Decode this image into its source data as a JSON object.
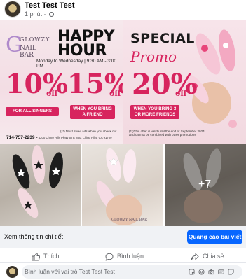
{
  "post": {
    "page_name": "Test Test Test",
    "time": "1 phút"
  },
  "banner": {
    "logo_brand": "GLOWZY",
    "logo_sub": "NAIL BAR",
    "happy_line1": "HAPPY",
    "happy_line2": "HOUR",
    "happy_time": "Monday to Wednesday  |  9:30 AM - 3:00 PM",
    "deal1_value": "10%",
    "deal1_off": "off",
    "deal1_label": "FOR ALL SINGERS",
    "deal2_value": "15%",
    "deal2_off": "off",
    "deal2_label_line1": "WHEN YOU BRING",
    "deal2_label_line2": "A FRIEND",
    "phone": "714-757-2239",
    "address": "• 4200 Chino Hills Pkwy STE 850, Chino Hills, CA  91709",
    "note1_line1": "(**) Must show ads when you check out",
    "note1_line2": "(**) Cannot combine with other promotions",
    "special": "SPECIAL",
    "promo": "Promo",
    "deal3_value": "20%",
    "deal3_off": "off",
    "deal3_label_line1": "WHEN YOU BRING 3",
    "deal3_label_line2": "OR MORE FRIENDS",
    "note2_line1": "(**)This offer is valid until the end of September 2024",
    "note2_line2": "and cannot be combined with other promotions",
    "brand_color": "#d7245e"
  },
  "photos": {
    "more_count": "+7",
    "watermark": "GLOWZY NAIL BAR"
  },
  "cta": {
    "link": "Xem thông tin chi tiết",
    "button": "Quảng cáo bài viết",
    "button_color": "#0866ff"
  },
  "actions": {
    "like": "Thích",
    "comment": "Bình luận",
    "share": "Chia sẻ"
  },
  "comment": {
    "placeholder": "Bình luận với vai trò Test Test Test"
  }
}
